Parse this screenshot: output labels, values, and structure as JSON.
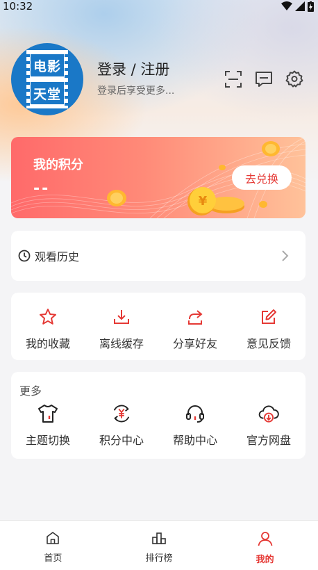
{
  "status_bar": {
    "time": "10:32"
  },
  "avatar": {
    "text_top": "电影",
    "text_bottom": "天堂"
  },
  "header": {
    "title": "登录 / 注册",
    "subtitle": "登录后享受更多..."
  },
  "header_icons": [
    "scan-icon",
    "message-icon",
    "settings-icon"
  ],
  "points": {
    "title": "我的积分",
    "value": "--",
    "button": "去兑换"
  },
  "history": {
    "label": "观看历史"
  },
  "quick_actions": [
    {
      "label": "我的收藏",
      "icon": "star-icon"
    },
    {
      "label": "离线缓存",
      "icon": "download-icon"
    },
    {
      "label": "分享好友",
      "icon": "share-icon"
    },
    {
      "label": "意见反馈",
      "icon": "feedback-icon"
    }
  ],
  "more": {
    "title": "更多",
    "items": [
      {
        "label": "主题切换",
        "icon": "theme-icon"
      },
      {
        "label": "积分中心",
        "icon": "points-center-icon"
      },
      {
        "label": "帮助中心",
        "icon": "headset-icon"
      },
      {
        "label": "官方网盘",
        "icon": "cloud-download-icon"
      }
    ]
  },
  "bottom_nav": [
    {
      "label": "首页",
      "icon": "home-icon",
      "active": false
    },
    {
      "label": "排行榜",
      "icon": "ranking-icon",
      "active": false
    },
    {
      "label": "我的",
      "icon": "person-icon",
      "active": true
    }
  ],
  "colors": {
    "accent": "#e53935",
    "avatar_blue": "#1a78c7",
    "card_gradient_start": "#ff6a6a",
    "card_gradient_end": "#ffc29a"
  }
}
